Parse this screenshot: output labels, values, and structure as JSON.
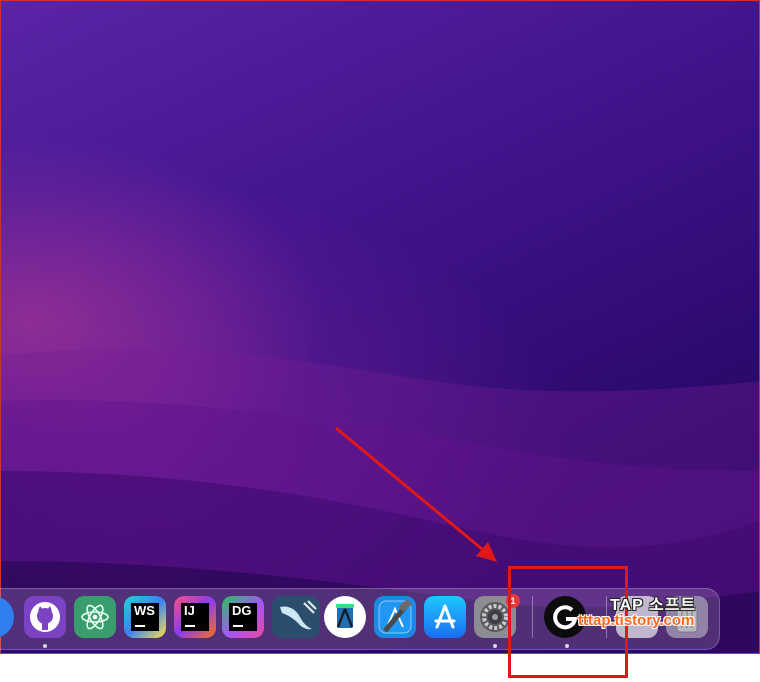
{
  "desktop": {
    "wallpaper": "purple-waves"
  },
  "dock": {
    "apps": [
      {
        "name": "partial-blue-app",
        "icon": "circle-icon"
      },
      {
        "name": "GitHub Desktop",
        "icon": "github-icon"
      },
      {
        "name": "Atom",
        "icon": "atom-icon"
      },
      {
        "name": "WebStorm",
        "icon": "webstorm-icon",
        "text": "WS"
      },
      {
        "name": "IntelliJ IDEA",
        "icon": "intellij-icon",
        "text": "IJ"
      },
      {
        "name": "DataGrip",
        "icon": "datagrip-icon",
        "text": "DG"
      },
      {
        "name": "MySQL Workbench",
        "icon": "mysql-dolphin-icon"
      },
      {
        "name": "Android Studio",
        "icon": "android-studio-icon"
      },
      {
        "name": "Xcode",
        "icon": "xcode-hammer-icon"
      },
      {
        "name": "App Store",
        "icon": "app-store-icon"
      },
      {
        "name": "System Preferences",
        "icon": "gear-icon",
        "badge": "1"
      },
      {
        "name": "Logitech G HUB",
        "icon": "logitech-g-icon"
      }
    ],
    "running_dots": [
      "GitHub Desktop",
      "System Preferences",
      "Logitech G HUB"
    ]
  },
  "watermark": {
    "title": "TAP 소프트",
    "url": "tttap.tistory.com"
  },
  "colors": {
    "highlight": "#e01818",
    "arrow": "#e01818",
    "badge": "#e8383a"
  }
}
